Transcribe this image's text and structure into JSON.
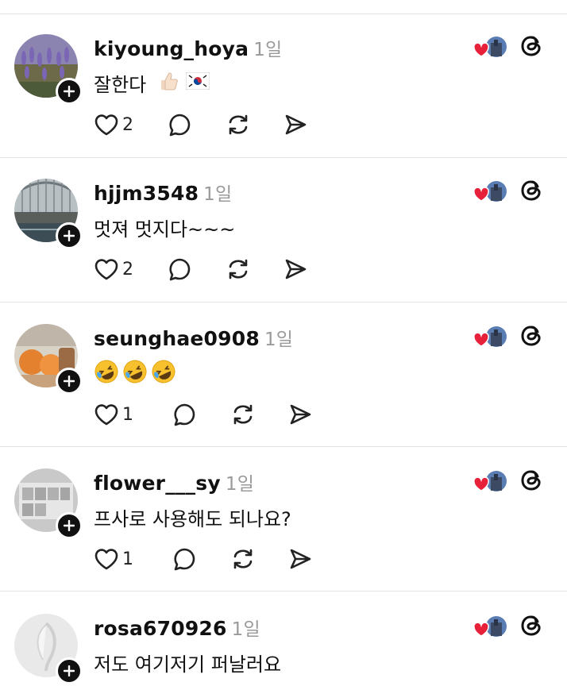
{
  "time_label": "1일",
  "posts": [
    {
      "username": "kiyoung_hoya",
      "text": "잘한다",
      "emojis": [
        "thumbs-up-light",
        "korea-flag"
      ],
      "likes": "2",
      "avatar": "lavender-field"
    },
    {
      "username": "hjjm3548",
      "text": "멋져 멋지다~~~",
      "emojis": [],
      "likes": "2",
      "avatar": "glass-arcade"
    },
    {
      "username": "seunghae0908",
      "text": "",
      "emojis": [
        "rofl",
        "rofl",
        "rofl"
      ],
      "likes": "1",
      "avatar": "orange-fruit"
    },
    {
      "username": "flower___sy",
      "text": "프사로 사용해도 되나요?",
      "emojis": [],
      "likes": "1",
      "avatar": "gray-sign"
    },
    {
      "username": "rosa670926",
      "text": "저도 여기저기 퍼날러요",
      "emojis": [],
      "likes": "",
      "avatar": "white-leaf"
    }
  ],
  "colors": {
    "accent_heart": "#e8213b",
    "badge": "#111111",
    "divider": "#e3e3e3",
    "muted": "#9a9a9a"
  },
  "icons": {
    "like": "heart-icon",
    "reply": "speech-bubble-icon",
    "repost": "repost-icon",
    "share": "send-icon",
    "app": "threads-logo-icon",
    "follow": "plus-icon"
  }
}
